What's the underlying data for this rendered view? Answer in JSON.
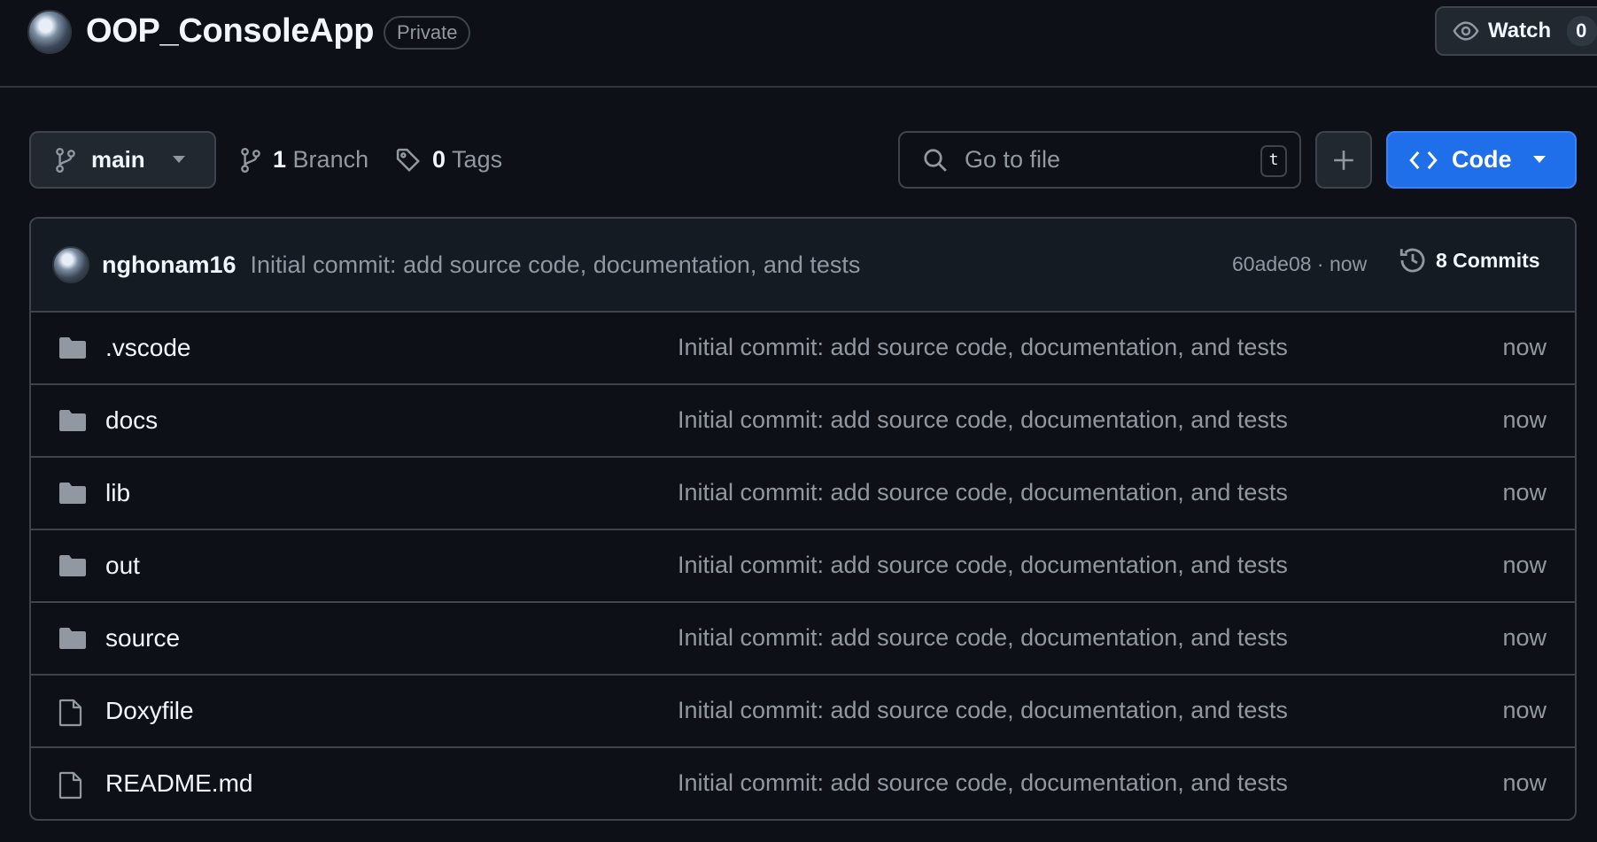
{
  "header": {
    "repo_name": "OOP_ConsoleApp",
    "visibility": "Private",
    "watch_label": "Watch",
    "watch_count": "0"
  },
  "toolbar": {
    "branch": "main",
    "branch_count": "1",
    "branch_label": "Branch",
    "tag_count": "0",
    "tag_label": "Tags",
    "search_placeholder": "Go to file",
    "search_shortcut": "t",
    "code_label": "Code"
  },
  "commit": {
    "author": "nghonam16",
    "message": "Initial commit: add source code, documentation, and tests",
    "meta": "60ade08 · now",
    "commits_label": "8 Commits"
  },
  "files": [
    {
      "name": ".vscode",
      "type": "folder",
      "message": "Initial commit: add source code, documentation, and tests",
      "time": "now"
    },
    {
      "name": "docs",
      "type": "folder",
      "message": "Initial commit: add source code, documentation, and tests",
      "time": "now"
    },
    {
      "name": "lib",
      "type": "folder",
      "message": "Initial commit: add source code, documentation, and tests",
      "time": "now"
    },
    {
      "name": "out",
      "type": "folder",
      "message": "Initial commit: add source code, documentation, and tests",
      "time": "now"
    },
    {
      "name": "source",
      "type": "folder",
      "message": "Initial commit: add source code, documentation, and tests",
      "time": "now"
    },
    {
      "name": "Doxyfile",
      "type": "file",
      "message": "Initial commit: add source code, documentation, and tests",
      "time": "now"
    },
    {
      "name": "README.md",
      "type": "file",
      "message": "Initial commit: add source code, documentation, and tests",
      "time": "now"
    }
  ],
  "colors": {
    "background": "#0d1117",
    "border": "#3d444d",
    "muted_text": "#9198a1",
    "primary_button": "#1f6feb"
  }
}
